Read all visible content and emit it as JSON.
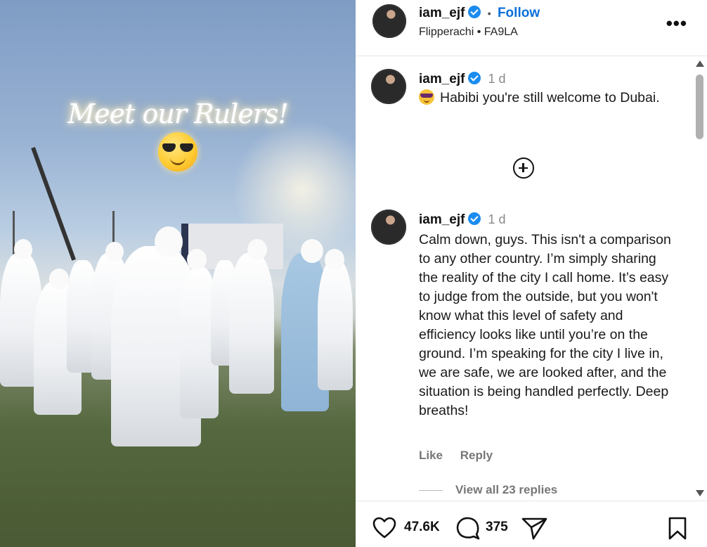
{
  "media": {
    "overlay_text": "Meet our Rulers!",
    "overlay_emoji": "smiling-face-with-sunglasses"
  },
  "header": {
    "username": "iam_ejf",
    "separator": "•",
    "follow_label": "Follow",
    "audio_artist": "Flipperachi",
    "audio_separator": "•",
    "audio_title": "FA9LA",
    "more_label": "•••"
  },
  "comments": [
    {
      "author": "iam_ejf",
      "time": "1 d",
      "emoji": "smiling-face-with-sunglasses",
      "text": "Habibi you're still welcome to Dubai."
    },
    {
      "author": "iam_ejf",
      "time": "1 d",
      "text": "Calm down, guys. This isn't a comparison to any other country. I’m simply sharing the reality of the city I call home. It’s easy to judge from the outside, but you won't know what this level of safety and efficiency looks like until you’re on the ground. I’m speaking for the city I live in, we are safe, we are looked after, and the situation is being handled perfectly. Deep breaths!",
      "like_label": "Like",
      "reply_label": "Reply",
      "view_replies_label": "View all 23 replies"
    }
  ],
  "footer": {
    "likes": "47.6K",
    "comments": "375"
  },
  "colors": {
    "verified": "#1a8cf0",
    "follow": "#0a6fd8",
    "muted_text": "#777777"
  }
}
